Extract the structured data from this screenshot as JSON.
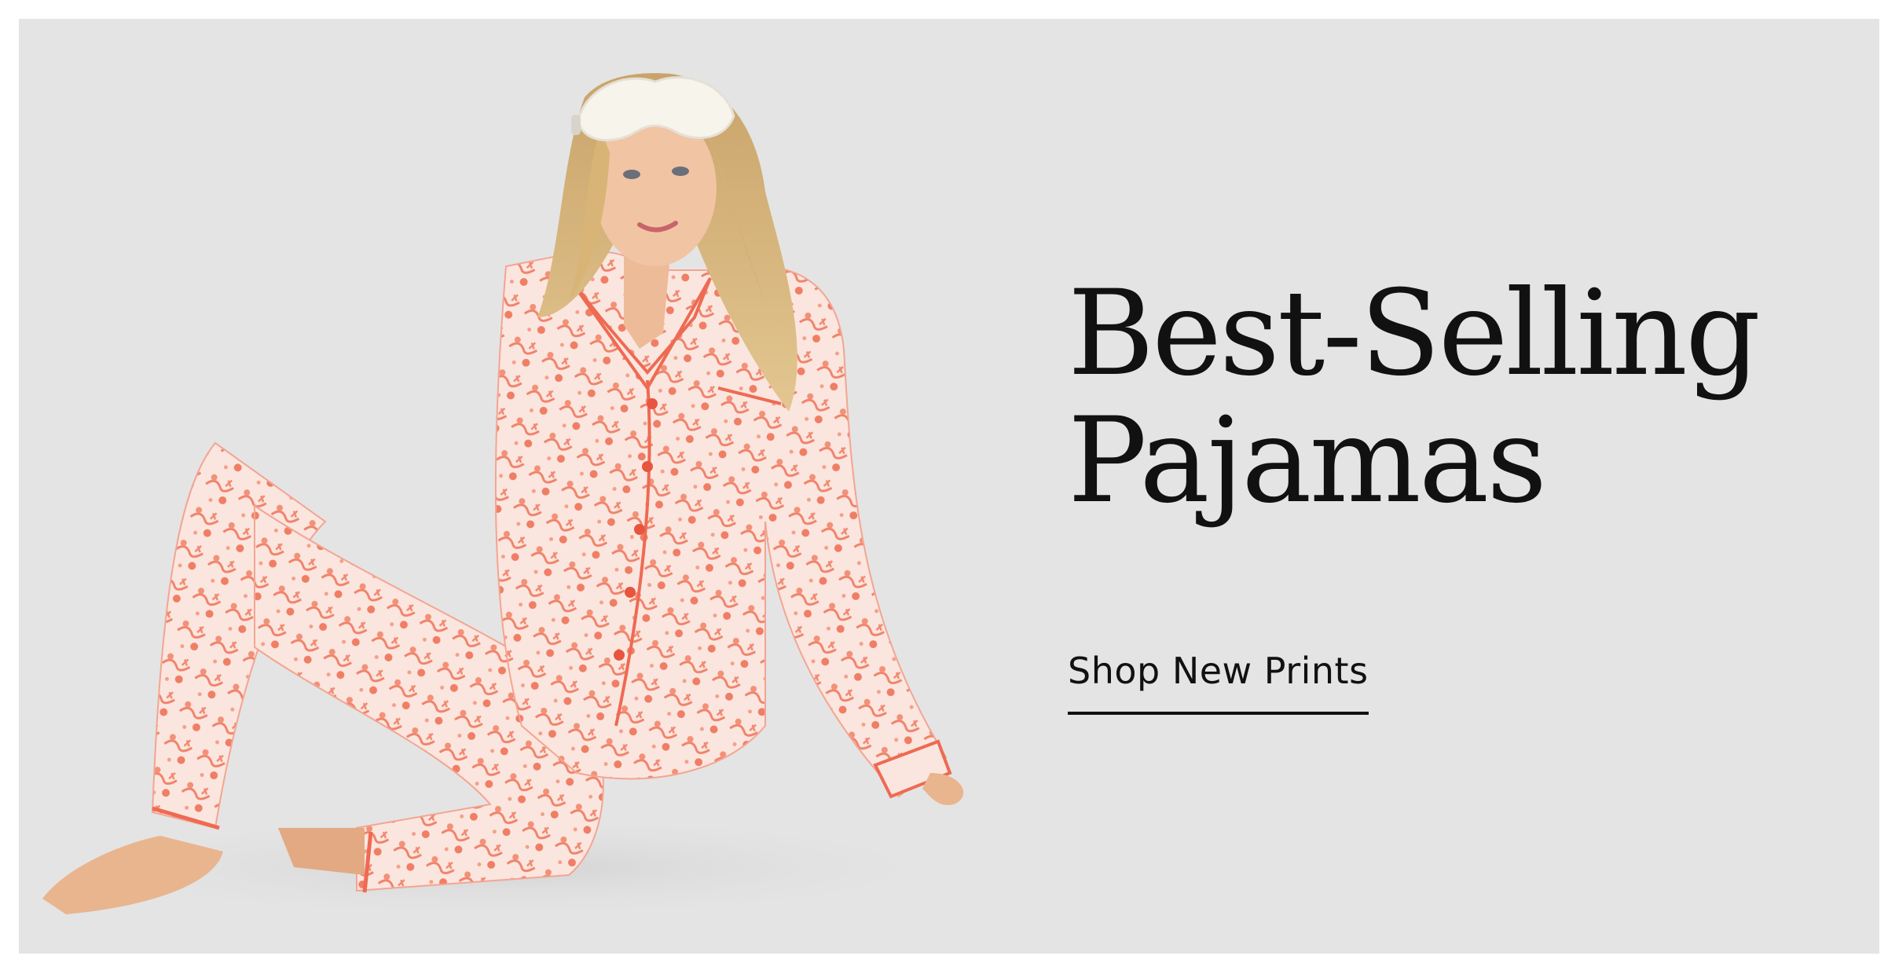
{
  "hero": {
    "headline_line1": "Best-Selling",
    "headline_line2": "Pajamas",
    "cta_label": "Shop New Prints",
    "image_alt": "Model in floral print pajama set with sleep mask"
  },
  "colors": {
    "background": "#e4e4e4",
    "print_coral": "#f07a62",
    "fabric_cream": "#fbe8e2",
    "text": "#111111"
  }
}
